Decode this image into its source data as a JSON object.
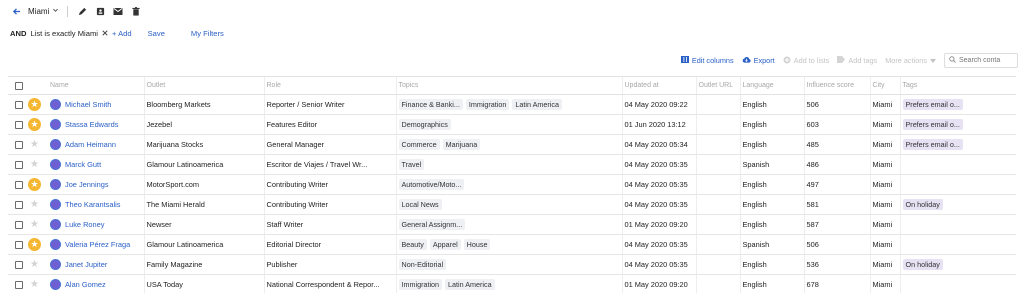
{
  "topbar": {
    "list_name": "Miami",
    "back_icon": "arrow-left-icon",
    "caret_icon": "chevron-down-icon"
  },
  "filters": {
    "operator": "AND",
    "chip": "List is exactly Miami",
    "add": "+ Add",
    "save": "Save",
    "my_filters": "My Filters"
  },
  "actions": {
    "edit_columns": "Edit columns",
    "export": "Export",
    "add_to_lists": "Add to lists",
    "add_tags": "Add tags",
    "more_actions": "More actions",
    "search_placeholder": "Search conta"
  },
  "columns": {
    "name": "Name",
    "outlet": "Outlet",
    "role": "Role",
    "topics": "Topics",
    "updated_at": "Updated at",
    "outlet_url": "Outlet URL",
    "language": "Language",
    "influence": "Influence score",
    "city": "City",
    "tags": "Tags"
  },
  "colors": {
    "link": "#2b60c6",
    "star": "#f5b731",
    "tag_bg": "#e7e2f3",
    "topic_bg": "#eef0f4"
  },
  "rows": [
    {
      "starred": true,
      "name": "Michael Smith",
      "outlet": "Bloomberg Markets",
      "role": "Reporter / Senior Writer",
      "topics": [
        "Finance & Banki...",
        "Immigration",
        "Latin America"
      ],
      "updated": "04 May 2020 09:22",
      "language": "English",
      "score": "506",
      "city": "Miami",
      "tag": "Prefers email o..."
    },
    {
      "starred": true,
      "name": "Stassa Edwards",
      "outlet": "Jezebel",
      "role": "Features Editor",
      "topics": [
        "Demographics"
      ],
      "updated": "01 Jun 2020 13:12",
      "language": "English",
      "score": "603",
      "city": "Miami",
      "tag": "Prefers email o..."
    },
    {
      "starred": false,
      "name": "Adam Heimann",
      "outlet": "Marijuana Stocks",
      "role": "General Manager",
      "topics": [
        "Commerce",
        "Marijuana"
      ],
      "updated": "04 May 2020 05:34",
      "language": "English",
      "score": "485",
      "city": "Miami",
      "tag": "Prefers email o..."
    },
    {
      "starred": false,
      "name": "Marck Gutt",
      "outlet": "Glamour Latinoamerica",
      "role": "Escritor de Viajes / Travel Wr...",
      "topics": [
        "Travel"
      ],
      "updated": "04 May 2020 05:35",
      "language": "Spanish",
      "score": "486",
      "city": "Miami",
      "tag": ""
    },
    {
      "starred": true,
      "name": "Joe Jennings",
      "outlet": "MotorSport.com",
      "role": "Contributing Writer",
      "topics": [
        "Automotive/Moto..."
      ],
      "updated": "04 May 2020 05:35",
      "language": "English",
      "score": "497",
      "city": "Miami",
      "tag": ""
    },
    {
      "starred": false,
      "name": "Theo Karantsalis",
      "outlet": "The Miami Herald",
      "role": "Contributing Writer",
      "topics": [
        "Local News"
      ],
      "updated": "04 May 2020 05:35",
      "language": "English",
      "score": "581",
      "city": "Miami",
      "tag": "On holiday"
    },
    {
      "starred": false,
      "name": "Luke Roney",
      "outlet": "Newser",
      "role": "Staff Writer",
      "topics": [
        "General Assignm..."
      ],
      "updated": "01 May 2020 09:20",
      "language": "English",
      "score": "587",
      "city": "Miami",
      "tag": ""
    },
    {
      "starred": true,
      "name": "Valeria Pérez Fraga",
      "outlet": "Glamour Latinoamerica",
      "role": "Editorial Director",
      "topics": [
        "Beauty",
        "Apparel",
        "House"
      ],
      "updated": "04 May 2020 05:35",
      "language": "Spanish",
      "score": "506",
      "city": "Miami",
      "tag": ""
    },
    {
      "starred": false,
      "name": "Janet Jupiter",
      "outlet": "Family Magazine",
      "role": "Publisher",
      "topics": [
        "Non-Editorial"
      ],
      "updated": "04 May 2020 05:35",
      "language": "English",
      "score": "536",
      "city": "Miami",
      "tag": "On holiday"
    },
    {
      "starred": false,
      "name": "Alan Gomez",
      "outlet": "USA Today",
      "role": "National Correspondent & Repor...",
      "topics": [
        "Immigration",
        "Latin America"
      ],
      "updated": "01 May 2020 09:20",
      "language": "English",
      "score": "678",
      "city": "Miami",
      "tag": ""
    }
  ]
}
